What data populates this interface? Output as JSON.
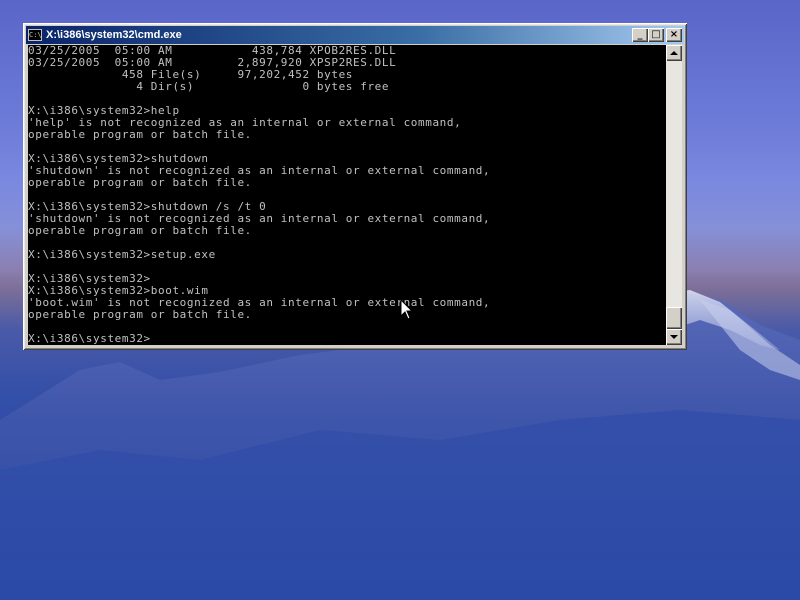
{
  "window": {
    "title": "X:\\i386\\system32\\cmd.exe",
    "icon": "cmd-icon",
    "buttons": {
      "minimize": "_",
      "maximize": "□",
      "close": "×"
    }
  },
  "console": {
    "lines": [
      "03/25/2005  05:00 AM           438,784 XPOB2RES.DLL",
      "03/25/2005  05:00 AM         2,897,920 XPSP2RES.DLL",
      "             458 File(s)     97,202,452 bytes",
      "               4 Dir(s)               0 bytes free",
      "",
      "X:\\i386\\system32>help",
      "'help' is not recognized as an internal or external command,",
      "operable program or batch file.",
      "",
      "X:\\i386\\system32>shutdown",
      "'shutdown' is not recognized as an internal or external command,",
      "operable program or batch file.",
      "",
      "X:\\i386\\system32>shutdown /s /t 0",
      "'shutdown' is not recognized as an internal or external command,",
      "operable program or batch file.",
      "",
      "X:\\i386\\system32>setup.exe",
      "",
      "X:\\i386\\system32>",
      "X:\\i386\\system32>boot.wim",
      "'boot.wim' is not recognized as an internal or external command,",
      "operable program or batch file.",
      "",
      "X:\\i386\\system32>"
    ]
  },
  "colors": {
    "console_bg": "#000000",
    "console_fg": "#c0c0c0",
    "titlebar_start": "#0a246a",
    "titlebar_end": "#a6caf0"
  }
}
